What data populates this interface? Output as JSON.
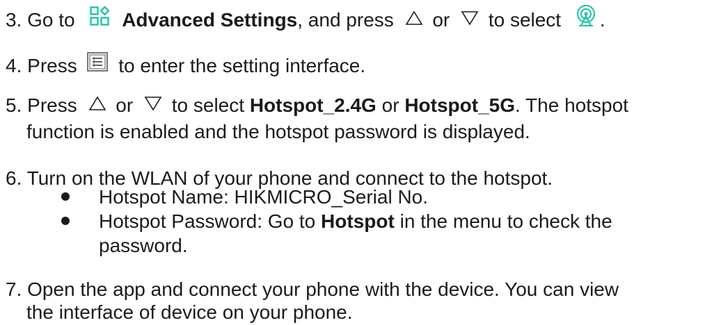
{
  "colors": {
    "accent": "#29c4a9",
    "text": "#1b1b1b"
  },
  "steps": [
    {
      "num": "3.",
      "t1": "Go to",
      "icon1": "advanced-settings-icon",
      "b1": "Advanced Settings",
      "t2": ", and press",
      "icon2": "up-triangle-icon",
      "t3": "or",
      "icon3": "down-triangle-icon",
      "t4": "to select",
      "icon4": "hotspot-icon",
      "t5": "."
    },
    {
      "num": "4.",
      "t1": "Press",
      "icon1": "menu-icon",
      "t2": "to enter the setting interface."
    },
    {
      "num": "5.",
      "t1": "Press",
      "icon1": "up-triangle-icon",
      "t2": "or",
      "icon2": "down-triangle-icon",
      "t3": "to select",
      "b1": "Hotspot_2.4G",
      "t4": "or",
      "b2": "Hotspot_5G",
      "t5": ". The hotspot",
      "line2": "function is enabled and the hotspot password is displayed."
    },
    {
      "num": "6.",
      "t1": "Turn on the WLAN of your phone and connect to the hotspot.",
      "bullets": [
        {
          "text": "Hotspot Name: HIKMICRO_Serial No."
        },
        {
          "t1": "Hotspot Password: Go to",
          "b1": "Hotspot",
          "t2": "in the menu to check the",
          "line2": "password."
        }
      ]
    },
    {
      "num": "7.",
      "t1": "Open the app and connect your phone with the device. You can view",
      "line2": "the interface of device on your phone."
    }
  ]
}
